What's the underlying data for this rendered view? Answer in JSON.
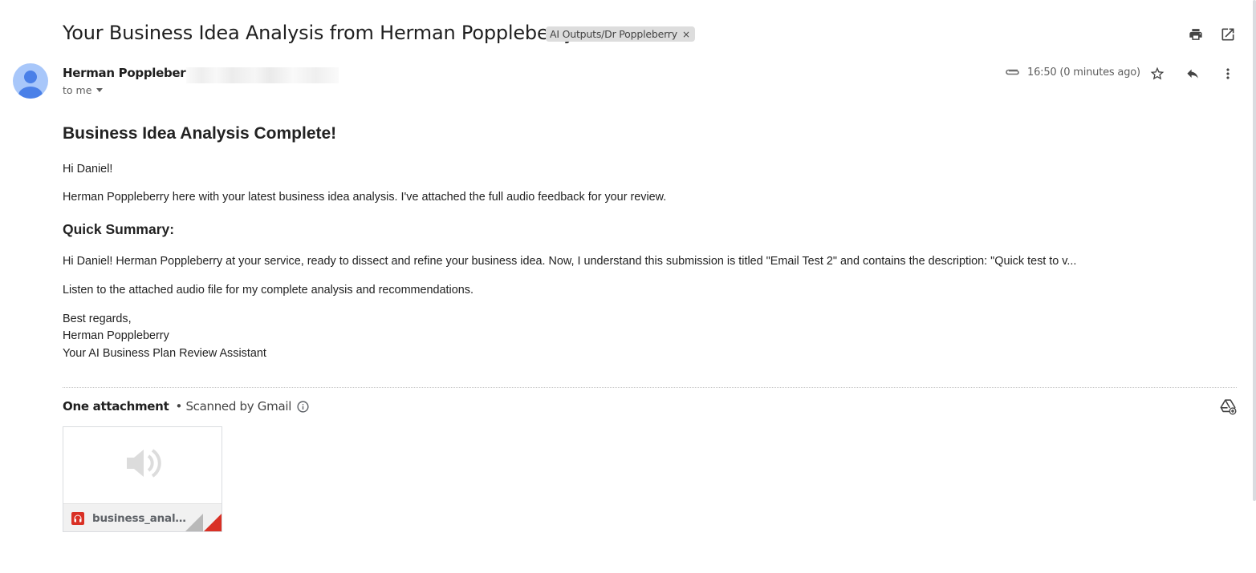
{
  "email": {
    "subject": "Your Business Idea Analysis from Herman Poppleberry",
    "label": "AI Outputs/Dr Poppleberry",
    "label_remove": "×",
    "sender_name": "Herman Poppleberry",
    "recipient": "to me",
    "timestamp": "16:50 (0 minutes ago)"
  },
  "body": {
    "heading": "Business Idea Analysis Complete!",
    "greeting": "Hi Daniel!",
    "intro": "Herman Poppleberry here with your latest business idea analysis. I've attached the full audio feedback for your review.",
    "summary_heading": "Quick Summary:",
    "summary": "Hi Daniel! Herman Poppleberry at your service, ready to dissect and refine your business idea. Now, I understand this submission is titled \"Email Test 2\" and contains the description: \"Quick test to v...",
    "cta": "Listen to the attached audio file for my complete analysis and recommendations.",
    "signoff": "Best regards,",
    "signature_name": "Herman Poppleberry",
    "signature_title": "Your AI Business Plan Review Assistant"
  },
  "attachments": {
    "header": "One attachment",
    "scanned": "• Scanned by Gmail",
    "items": [
      {
        "filename": "business_analysis",
        "type_icon": "audio-file-icon"
      }
    ]
  },
  "icons": {
    "print": "print-icon",
    "open_new": "open-in-new-window-icon",
    "paperclip": "paperclip-icon",
    "star": "star-icon",
    "reply": "reply-icon",
    "more": "more-vert-icon",
    "info": "info-icon",
    "drive": "add-to-drive-icon",
    "audio_preview": "speaker-icon"
  },
  "colors": {
    "avatar_bg": "#a8c7fa",
    "avatar_fg": "#4a80e8",
    "label_chip_bg": "#dddddd",
    "audio_badge": "#d93025"
  }
}
